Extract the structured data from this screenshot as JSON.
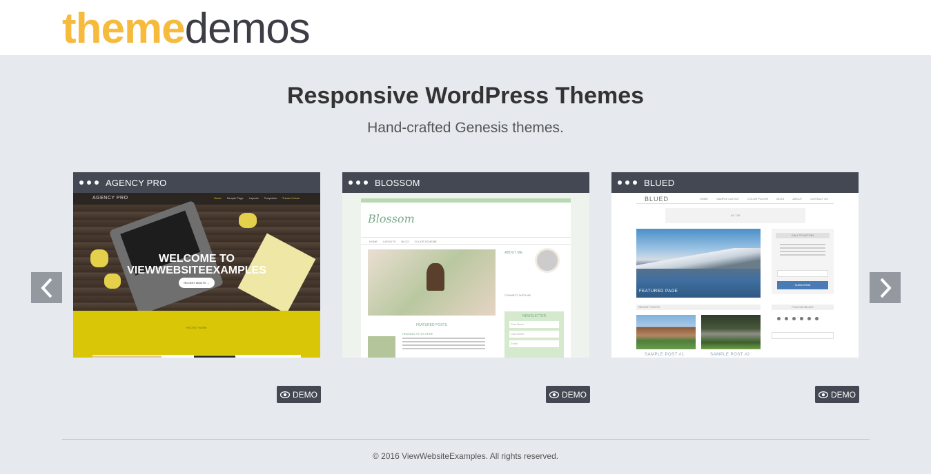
{
  "header": {
    "logo_bold": "theme",
    "logo_light": "demos"
  },
  "hero": {
    "title": "Responsive WordPress Themes",
    "subtitle": "Hand-crafted Genesis themes."
  },
  "carousel": {
    "prev_icon": "chevron-left-icon",
    "next_icon": "chevron-right-icon",
    "cards": [
      {
        "title": "AGENCY PRO",
        "demo_label": "DEMO",
        "preview": {
          "logo": "AGENCY PRO",
          "nav": [
            "Home",
            "Sample Page",
            "Layouts",
            "Templates",
            "Theme Colors"
          ],
          "headline_1": "WELCOME TO",
          "headline_2": "VIEWWEBSITEEXAMPLES",
          "cta": "RECENT MONTH →",
          "section": "RECENT WORK"
        }
      },
      {
        "title": "BLOSSOM",
        "demo_label": "DEMO",
        "preview": {
          "logo": "Blossom",
          "nav": [
            "HOME",
            "LAYOUTS",
            "BLOG",
            "COLOR SCHEME"
          ],
          "about": "ABOUT ME",
          "connect": "CONNECT WITH ME",
          "featured": "FEATURED POSTS",
          "post_title": "HEADING STYLE HERE",
          "newsletter": "NEWSLETTER",
          "fields": [
            "First Name",
            "Last Name",
            "Email"
          ]
        }
      },
      {
        "title": "BLUED",
        "demo_label": "DEMO",
        "preview": {
          "logo": "BLUED",
          "nav": [
            "HOME",
            "SAMPLE LAYOUT",
            "COLOR PICKER",
            "BLOG",
            "ABOUT",
            "CONTACT US"
          ],
          "ad": "AD 728",
          "feature_caption": "FEATURED PAGE",
          "sidebar_title": "CALL TO ACTION",
          "subscribe": "SUBSCRIBE",
          "recent": "RECENT POSTS",
          "follow": "FOLLOW BLUED",
          "post_1": "SAMPLE POST #1",
          "post_2": "SAMPLE POST #2"
        }
      }
    ]
  },
  "footer": {
    "copyright": "© 2016 ViewWebsiteExamples. All rights reserved."
  },
  "colors": {
    "logo_accent": "#f6ba3d",
    "logo_dark": "#3d3e45",
    "page_bg": "#e6e9ee",
    "card_bar": "#434853",
    "arrow_bg": "#94989f"
  }
}
